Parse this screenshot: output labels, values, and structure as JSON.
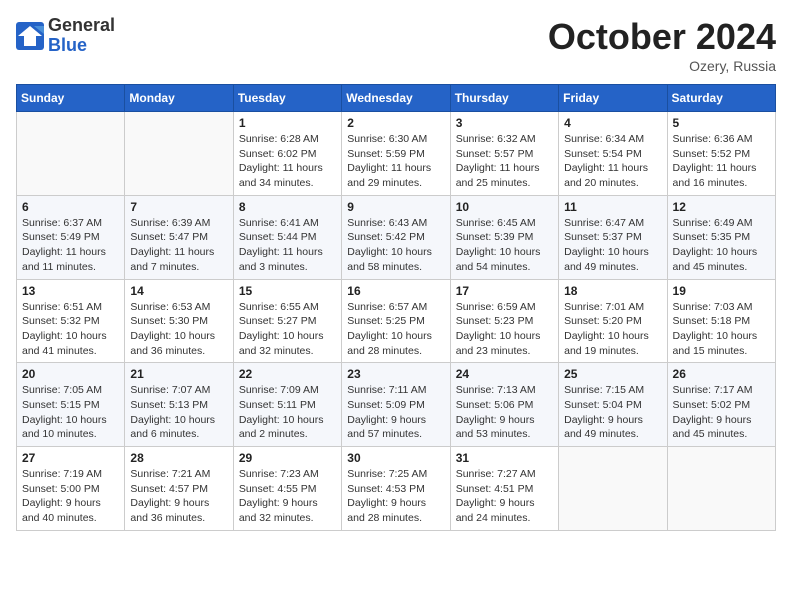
{
  "logo": {
    "general": "General",
    "blue": "Blue"
  },
  "title": "October 2024",
  "location": "Ozery, Russia",
  "weekdays": [
    "Sunday",
    "Monday",
    "Tuesday",
    "Wednesday",
    "Thursday",
    "Friday",
    "Saturday"
  ],
  "weeks": [
    [
      null,
      null,
      {
        "day": 1,
        "sunrise": "6:28 AM",
        "sunset": "6:02 PM",
        "daylight": "11 hours and 34 minutes."
      },
      {
        "day": 2,
        "sunrise": "6:30 AM",
        "sunset": "5:59 PM",
        "daylight": "11 hours and 29 minutes."
      },
      {
        "day": 3,
        "sunrise": "6:32 AM",
        "sunset": "5:57 PM",
        "daylight": "11 hours and 25 minutes."
      },
      {
        "day": 4,
        "sunrise": "6:34 AM",
        "sunset": "5:54 PM",
        "daylight": "11 hours and 20 minutes."
      },
      {
        "day": 5,
        "sunrise": "6:36 AM",
        "sunset": "5:52 PM",
        "daylight": "11 hours and 16 minutes."
      }
    ],
    [
      {
        "day": 6,
        "sunrise": "6:37 AM",
        "sunset": "5:49 PM",
        "daylight": "11 hours and 11 minutes."
      },
      {
        "day": 7,
        "sunrise": "6:39 AM",
        "sunset": "5:47 PM",
        "daylight": "11 hours and 7 minutes."
      },
      {
        "day": 8,
        "sunrise": "6:41 AM",
        "sunset": "5:44 PM",
        "daylight": "11 hours and 3 minutes."
      },
      {
        "day": 9,
        "sunrise": "6:43 AM",
        "sunset": "5:42 PM",
        "daylight": "10 hours and 58 minutes."
      },
      {
        "day": 10,
        "sunrise": "6:45 AM",
        "sunset": "5:39 PM",
        "daylight": "10 hours and 54 minutes."
      },
      {
        "day": 11,
        "sunrise": "6:47 AM",
        "sunset": "5:37 PM",
        "daylight": "10 hours and 49 minutes."
      },
      {
        "day": 12,
        "sunrise": "6:49 AM",
        "sunset": "5:35 PM",
        "daylight": "10 hours and 45 minutes."
      }
    ],
    [
      {
        "day": 13,
        "sunrise": "6:51 AM",
        "sunset": "5:32 PM",
        "daylight": "10 hours and 41 minutes."
      },
      {
        "day": 14,
        "sunrise": "6:53 AM",
        "sunset": "5:30 PM",
        "daylight": "10 hours and 36 minutes."
      },
      {
        "day": 15,
        "sunrise": "6:55 AM",
        "sunset": "5:27 PM",
        "daylight": "10 hours and 32 minutes."
      },
      {
        "day": 16,
        "sunrise": "6:57 AM",
        "sunset": "5:25 PM",
        "daylight": "10 hours and 28 minutes."
      },
      {
        "day": 17,
        "sunrise": "6:59 AM",
        "sunset": "5:23 PM",
        "daylight": "10 hours and 23 minutes."
      },
      {
        "day": 18,
        "sunrise": "7:01 AM",
        "sunset": "5:20 PM",
        "daylight": "10 hours and 19 minutes."
      },
      {
        "day": 19,
        "sunrise": "7:03 AM",
        "sunset": "5:18 PM",
        "daylight": "10 hours and 15 minutes."
      }
    ],
    [
      {
        "day": 20,
        "sunrise": "7:05 AM",
        "sunset": "5:15 PM",
        "daylight": "10 hours and 10 minutes."
      },
      {
        "day": 21,
        "sunrise": "7:07 AM",
        "sunset": "5:13 PM",
        "daylight": "10 hours and 6 minutes."
      },
      {
        "day": 22,
        "sunrise": "7:09 AM",
        "sunset": "5:11 PM",
        "daylight": "10 hours and 2 minutes."
      },
      {
        "day": 23,
        "sunrise": "7:11 AM",
        "sunset": "5:09 PM",
        "daylight": "9 hours and 57 minutes."
      },
      {
        "day": 24,
        "sunrise": "7:13 AM",
        "sunset": "5:06 PM",
        "daylight": "9 hours and 53 minutes."
      },
      {
        "day": 25,
        "sunrise": "7:15 AM",
        "sunset": "5:04 PM",
        "daylight": "9 hours and 49 minutes."
      },
      {
        "day": 26,
        "sunrise": "7:17 AM",
        "sunset": "5:02 PM",
        "daylight": "9 hours and 45 minutes."
      }
    ],
    [
      {
        "day": 27,
        "sunrise": "7:19 AM",
        "sunset": "5:00 PM",
        "daylight": "9 hours and 40 minutes."
      },
      {
        "day": 28,
        "sunrise": "7:21 AM",
        "sunset": "4:57 PM",
        "daylight": "9 hours and 36 minutes."
      },
      {
        "day": 29,
        "sunrise": "7:23 AM",
        "sunset": "4:55 PM",
        "daylight": "9 hours and 32 minutes."
      },
      {
        "day": 30,
        "sunrise": "7:25 AM",
        "sunset": "4:53 PM",
        "daylight": "9 hours and 28 minutes."
      },
      {
        "day": 31,
        "sunrise": "7:27 AM",
        "sunset": "4:51 PM",
        "daylight": "9 hours and 24 minutes."
      },
      null,
      null
    ]
  ],
  "labels": {
    "sunrise": "Sunrise:",
    "sunset": "Sunset:",
    "daylight": "Daylight:"
  }
}
